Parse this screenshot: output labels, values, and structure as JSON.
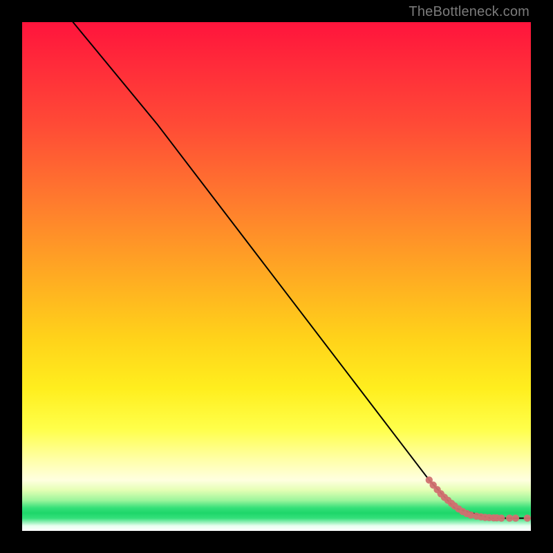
{
  "watermark": "TheBottleneck.com",
  "chart_data": {
    "type": "line",
    "title": "",
    "xlabel": "",
    "ylabel": "",
    "xlim": [
      0,
      100
    ],
    "ylim": [
      0,
      100
    ],
    "grid": false,
    "series": [
      {
        "name": "curve",
        "style": "line",
        "color": "#000000",
        "x": [
          10,
          26.5,
          80,
          85,
          92,
          100
        ],
        "y": [
          100,
          80,
          10,
          4.5,
          2.5,
          2.5
        ]
      },
      {
        "name": "tail-points",
        "style": "scatter",
        "color": "#d07070",
        "x": [
          80.0,
          80.8,
          81.6,
          82.3,
          83.0,
          83.7,
          84.4,
          85.0,
          85.8,
          86.6,
          87.4,
          88.2,
          89.3,
          90.2,
          91.0,
          91.8,
          92.7,
          93.3,
          94.2,
          95.8,
          97.0,
          99.3
        ],
        "y": [
          10.0,
          9.0,
          8.1,
          7.3,
          6.6,
          6.0,
          5.4,
          4.9,
          4.3,
          3.8,
          3.4,
          3.1,
          2.9,
          2.75,
          2.65,
          2.6,
          2.55,
          2.55,
          2.5,
          2.5,
          2.5,
          2.5
        ]
      }
    ]
  }
}
